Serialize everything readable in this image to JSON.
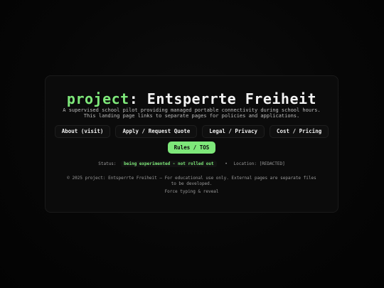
{
  "header": {
    "title_accent": "project",
    "title_rest": ": Entsperrte Freiheit",
    "subtitle": "A supervised school pilot providing managed portable connectivity during school hours. This landing page links to separate pages for policies and applications."
  },
  "nav": {
    "items": [
      {
        "label": "About (visit)"
      },
      {
        "label": "Apply / Request Quote"
      },
      {
        "label": "Legal / Privacy"
      },
      {
        "label": "Cost / Pricing"
      }
    ],
    "primary": {
      "label": "Rules / TOS"
    }
  },
  "status": {
    "label": "Status:",
    "value": "being experimented - not rolled out",
    "separator": "•",
    "location_label": "Location:",
    "location_value": "[REDACTED]"
  },
  "footer": {
    "text": "© 2025 project: Entsperrte Freiheit — For educational use only. External pages are separate files to be developed.",
    "force_link": "Force typing & reveal"
  },
  "colors": {
    "accent": "#7ee87a",
    "background": "#050505",
    "card": "#0b0b0b"
  }
}
